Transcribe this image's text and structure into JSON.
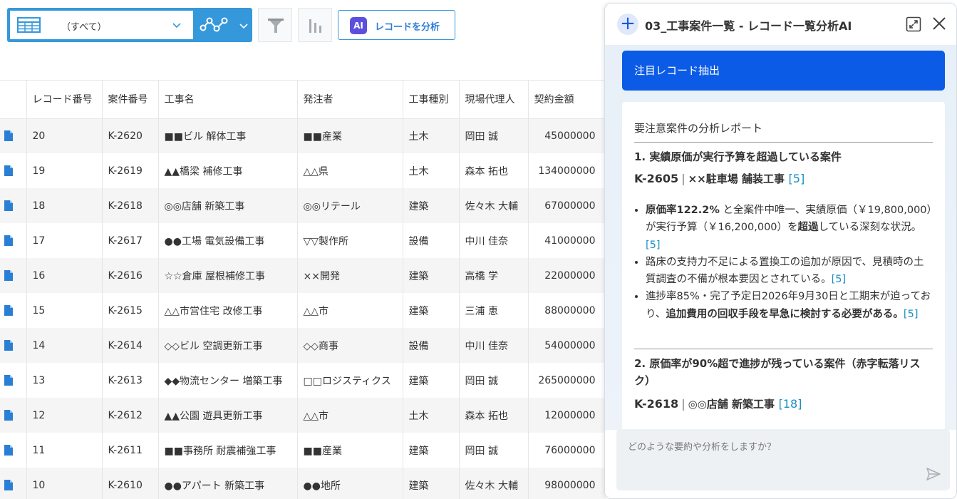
{
  "toolbar": {
    "view_label": "（すべて）",
    "analyze_label": "レコードを分析",
    "ai_badge": "AI"
  },
  "table": {
    "headers": [
      "レコード番号",
      "案件番号",
      "工事名",
      "発注者",
      "工事種別",
      "現場代理人",
      "契約金額"
    ],
    "rows": [
      [
        "20",
        "K-2620",
        "■■ビル 解体工事",
        "■■産業",
        "土木",
        "岡田 誠",
        "45000000"
      ],
      [
        "19",
        "K-2619",
        "▲▲橋梁 補修工事",
        "△△県",
        "土木",
        "森本 拓也",
        "134000000"
      ],
      [
        "18",
        "K-2618",
        "◎◎店舗 新築工事",
        "◎◎リテール",
        "建築",
        "佐々木 大輔",
        "67000000"
      ],
      [
        "17",
        "K-2617",
        "●●工場 電気設備工事",
        "▽▽製作所",
        "設備",
        "中川 佳奈",
        "41000000"
      ],
      [
        "16",
        "K-2616",
        "☆☆倉庫 屋根補修工事",
        "××開発",
        "建築",
        "高橋 学",
        "22000000"
      ],
      [
        "15",
        "K-2615",
        "△△市営住宅 改修工事",
        "△△市",
        "建築",
        "三浦 恵",
        "88000000"
      ],
      [
        "14",
        "K-2614",
        "◇◇ビル 空調更新工事",
        "◇◇商事",
        "設備",
        "中川 佳奈",
        "54000000"
      ],
      [
        "13",
        "K-2613",
        "◆◆物流センター 増築工事",
        "□□ロジスティクス",
        "建築",
        "岡田 誠",
        "265000000"
      ],
      [
        "12",
        "K-2612",
        "▲▲公園 遊具更新工事",
        "△△市",
        "土木",
        "森本 拓也",
        "12000000"
      ],
      [
        "11",
        "K-2611",
        "■■事務所 耐震補強工事",
        "■■産業",
        "建築",
        "岡田 誠",
        "76000000"
      ],
      [
        "10",
        "K-2610",
        "●●アパート 新築工事",
        "●●地所",
        "建築",
        "佐々木 大輔",
        "98000000"
      ]
    ]
  },
  "ai_panel": {
    "title": "03_工事案件一覧 - レコード一覧分析AI",
    "extract_button": "注目レコード抽出",
    "report_title": "要注意案件の分析レポート",
    "section1": {
      "heading": "1. 実績原価が実行予算を超過している案件",
      "case_no": "K-2605",
      "sep": "|",
      "case_name": "××駐車場 舗装工事",
      "ref": "5",
      "b1_bold1": "原価率122.2%",
      "b1_text1": " と全案件中唯一、実績原価（￥19,800,000）が実行予算（￥16,200,000）を",
      "b1_bold2": "超過",
      "b1_text2": "している深刻な状況。",
      "b2_text": "路床の支持力不足による置換工の追加が原因で、見積時の土質調査の不備が根本要因とされている。",
      "b3_text": "進捗率85%・完了予定日2026年9月30日と工期末が迫っており、",
      "b3_bold": "追加費用の回収手段を早急に検討する必要がある。"
    },
    "section2": {
      "heading": "2. 原価率が90%超で進捗が残っている案件（赤字転落リスク）",
      "case_no": "K-2618",
      "sep": "|",
      "case_name": "◎◎店舗 新築工事",
      "ref": "18"
    },
    "input_placeholder": "どのような要約や分析をしますか？"
  },
  "colors": {
    "primary_blue": "#3498db",
    "button_blue": "#0b5be6",
    "ai_purple": "#5b4fe0",
    "ref_link": "#1a8fc2"
  }
}
